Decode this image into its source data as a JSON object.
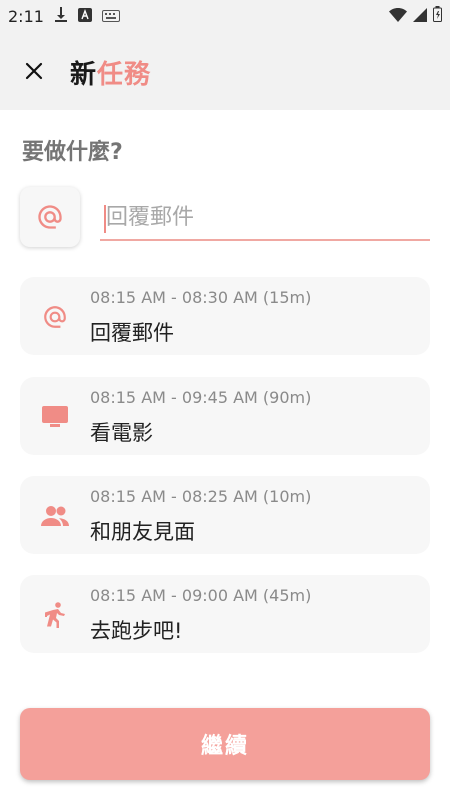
{
  "status_bar": {
    "time": "2:11",
    "icons": [
      "download-icon",
      "a-icon",
      "keyboard-icon",
      "wifi-icon",
      "signal-icon",
      "battery-icon"
    ]
  },
  "app_bar": {
    "close_icon": "close-icon",
    "title_part1": "新",
    "title_part2": "任務"
  },
  "question": "要做什麼?",
  "icon_picker": {
    "icon": "at-icon"
  },
  "task_input": {
    "value": "",
    "placeholder": "回覆郵件"
  },
  "suggestions": [
    {
      "icon": "at-icon",
      "time": "08:15 AM - 08:30 AM (15m)",
      "name": "回覆郵件"
    },
    {
      "icon": "tv-icon",
      "time": "08:15 AM - 09:45 AM (90m)",
      "name": "看電影"
    },
    {
      "icon": "people-icon",
      "time": "08:15 AM - 08:25 AM (10m)",
      "name": "和朋友見面"
    },
    {
      "icon": "run-icon",
      "time": "08:15 AM - 09:00 AM (45m)",
      "name": "去跑步吧!"
    }
  ],
  "continue_label": "繼續",
  "colors": {
    "accent": "#f08c86",
    "button": "#f4a09a",
    "card_bg": "#f7f7f7",
    "bar_bg": "#f2f2f2"
  }
}
